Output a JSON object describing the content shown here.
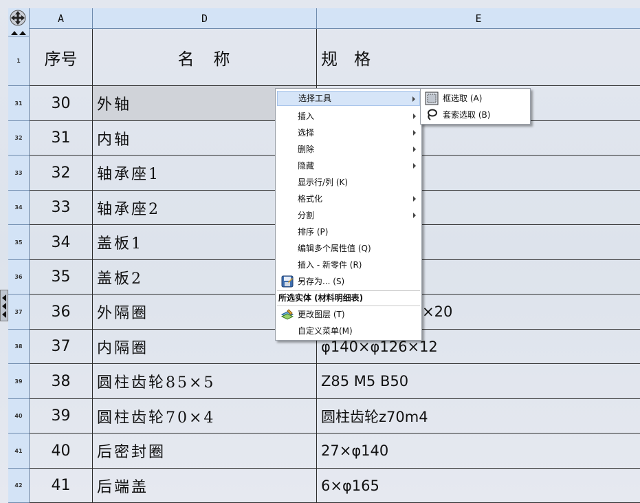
{
  "columns": {
    "a": "A",
    "d": "D",
    "e": "E"
  },
  "header_row": {
    "row_no": "1",
    "seq": "序号",
    "name": "名　称",
    "spec": "规　格"
  },
  "rows": [
    {
      "row_no": "31",
      "seq": "30",
      "name": "外轴",
      "spec": ""
    },
    {
      "row_no": "32",
      "seq": "31",
      "name": "内轴",
      "spec": ""
    },
    {
      "row_no": "33",
      "seq": "32",
      "name": "轴承座1",
      "spec": ""
    },
    {
      "row_no": "34",
      "seq": "33",
      "name": "轴承座2",
      "spec": ""
    },
    {
      "row_no": "35",
      "seq": "34",
      "name": "盖板1",
      "spec": ""
    },
    {
      "row_no": "36",
      "seq": "35",
      "name": "盖板2",
      "spec": ""
    },
    {
      "row_no": "37",
      "seq": "36",
      "name": "外隔圈",
      "spec": "×20"
    },
    {
      "row_no": "38",
      "seq": "37",
      "name": "内隔圈",
      "spec": "φ140×φ126×12"
    },
    {
      "row_no": "39",
      "seq": "38",
      "name": "圆柱齿轮85×5",
      "spec": "Z85 M5 B50"
    },
    {
      "row_no": "40",
      "seq": "39",
      "name": "圆柱齿轮70×4",
      "spec": "圆柱齿轮z70m4"
    },
    {
      "row_no": "41",
      "seq": "40",
      "name": "后密封圈",
      "spec": "27×φ140"
    },
    {
      "row_no": "42",
      "seq": "41",
      "name": "后端盖",
      "spec": "6×φ165"
    }
  ],
  "context_menu": {
    "select_tool": "选择工具",
    "insert": "插入",
    "select": "选择",
    "delete": "删除",
    "hide": "隐藏",
    "show_row_col": "显示行/列 (K)",
    "format": "格式化",
    "split": "分割",
    "sort": "排序 (P)",
    "edit_props": "编辑多个属性值 (Q)",
    "insert_part": "插入 - 新零件 (R)",
    "save_as": "另存为... (S)",
    "section": "所选实体 (材料明细表)",
    "change_layer": "更改图层 (T)",
    "customize": "自定义菜单(M)"
  },
  "submenu": {
    "box_select": "框选取 (A)",
    "lasso_select": "套索选取 (B)"
  }
}
